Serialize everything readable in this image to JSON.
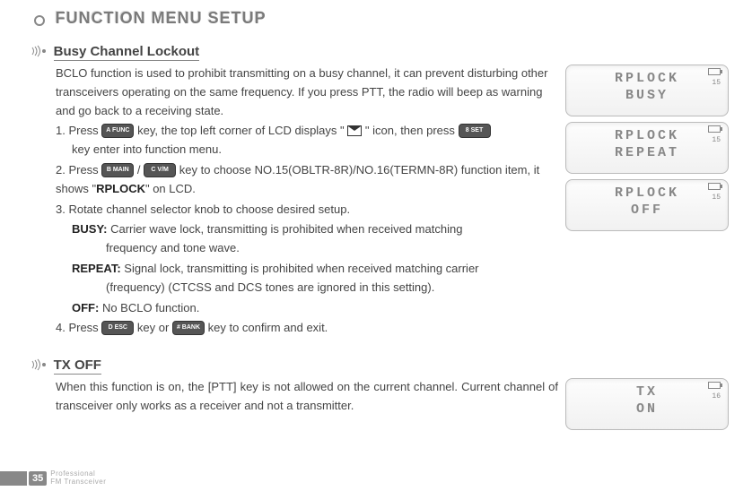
{
  "page_title": "FUNCTION MENU SETUP",
  "section1": {
    "title": "Busy Channel Lockout",
    "intro": "BCLO function is used to prohibit transmitting on a busy channel, it can prevent disturbing other transceivers operating on the same frequency. If you press PTT, the radio will beep as warning and go back to a receiving state.",
    "step1_a": "1. Press ",
    "step1_b": " key, the top left corner of LCD displays \" ",
    "step1_c": " \"  icon, then press ",
    "step1_d": " key enter into function menu.",
    "step2_a": "2. Press ",
    "step2_slash": " / ",
    "step2_b": " key  to choose NO.15(OBLTR-8R)/NO.16(TERMN-8R) function item, it shows \"",
    "step2_bold": "RPLOCK",
    "step2_c": "\" on LCD.",
    "step3": "3. Rotate channel selector knob to choose desired setup.",
    "busy_label": "BUSY:",
    "busy_text1": " Carrier wave lock, transmitting is prohibited when received matching",
    "busy_text2": "frequency and tone wave.",
    "repeat_label": "REPEAT:",
    "repeat_text1": " Signal lock, transmitting is prohibited when received matching carrier",
    "repeat_text2": "(frequency) (CTCSS and DCS tones are ignored in this setting).",
    "off_label": "OFF:",
    "off_text": " No BCLO function.",
    "step4_a": "4. Press ",
    "step4_b": " key or ",
    "step4_c": " key to confirm and exit."
  },
  "section2": {
    "title": "TX OFF",
    "body": "When this function is on, the [PTT] key is not allowed on the current channel. Current channel of transceiver only works as a receiver and not a transmitter."
  },
  "keys": {
    "a_func": "A FUNC",
    "eight_set": "8 SET",
    "b_main": "B MAIN",
    "c_vm": "C V/M",
    "d_esc": "D ESC",
    "hash_bank": "# BANK"
  },
  "lcds": [
    {
      "line1": "RPLOCK",
      "line2": "BUSY",
      "num": "15"
    },
    {
      "line1": "RPLOCK",
      "line2": "REPEAT",
      "num": "15"
    },
    {
      "line1": "RPLOCK",
      "line2": "OFF",
      "num": "15"
    },
    {
      "line1": "TX",
      "line2": "ON",
      "num": "16"
    }
  ],
  "footer": {
    "page_num": "35",
    "line1": "Professional",
    "line2": "FM Transceiver"
  }
}
